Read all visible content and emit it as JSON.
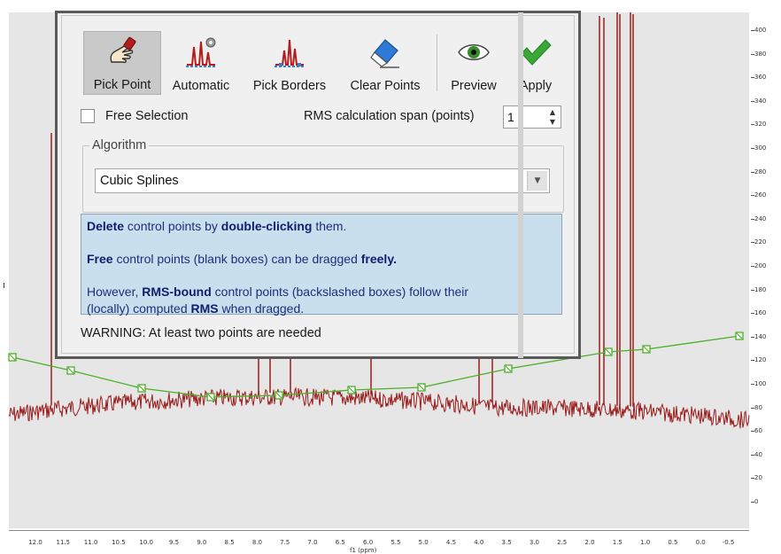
{
  "toolbar": {
    "pick_point": "Pick Point",
    "automatic": "Automatic",
    "pick_borders": "Pick Borders",
    "clear_points": "Clear Points",
    "preview": "Preview",
    "apply": "Apply"
  },
  "options": {
    "free_selection_label": "Free Selection",
    "free_selection_checked": false,
    "rms_label": "RMS calculation span (points)",
    "rms_value": "1"
  },
  "algorithm": {
    "legend": "Algorithm",
    "selected": "Cubic Splines"
  },
  "info": {
    "line1": {
      "b1": "Delete",
      "t1": " control points by ",
      "b2": "double-clicking",
      "t2": " them."
    },
    "line2": {
      "b1": "Free",
      "t1": " control points (blank boxes) can be dragged ",
      "b2": "freely."
    },
    "line3": {
      "t0": "However, ",
      "b1": "RMS-bound",
      "t1": " control points (backslashed boxes) follow their"
    },
    "line4": {
      "t0": "(locally) computed ",
      "b1": "RMS",
      "t1": " when dragged."
    }
  },
  "warning": "WARNING: At least two points are needed",
  "y_axis": {
    "ticks": [
      "400",
      "380",
      "360",
      "340",
      "320",
      "300",
      "280",
      "260",
      "240",
      "220",
      "200",
      "180",
      "160",
      "140",
      "120",
      "100",
      "80",
      "60",
      "40",
      "20",
      "0"
    ]
  },
  "x_axis": {
    "ticks": [
      "12.0",
      "11.5",
      "11.0",
      "10.5",
      "10.0",
      "9.5",
      "9.0",
      "8.5",
      "8.0",
      "7.5",
      "7.0",
      "6.5",
      "6.0",
      "5.5",
      "5.0",
      "4.5",
      "4.0",
      "3.5",
      "3.0",
      "2.5",
      "2.0",
      "1.5",
      "1.0",
      "0.5",
      "0.0",
      "-0.5"
    ],
    "label": "f1 (ppm)"
  },
  "colors": {
    "spectrum": "#9b1b1b",
    "baseline": "#4caf28",
    "plot_bg": "#e6e6e6",
    "dialog_bg": "#f0f0f0",
    "info_bg": "#c9dfee",
    "info_text": "#1c2f7a"
  },
  "icons": {
    "pick_point": "hand-pointer-icon",
    "automatic": "auto-peaks-gear-icon",
    "pick_borders": "peak-borders-icon",
    "clear_points": "eraser-icon",
    "preview": "eye-icon",
    "apply": "checkmark-icon"
  }
}
